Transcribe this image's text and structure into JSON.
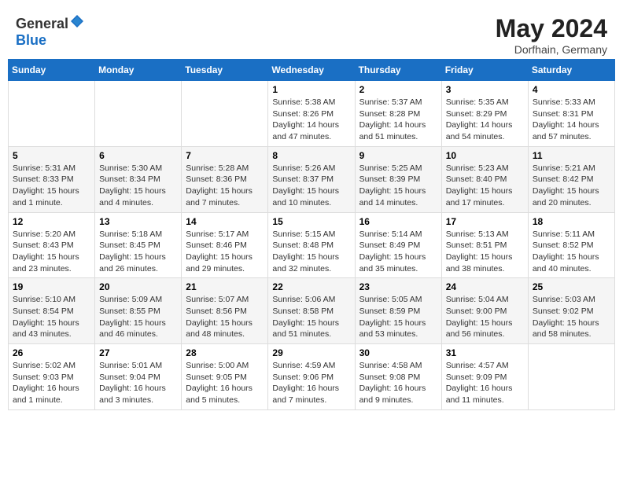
{
  "header": {
    "logo_general": "General",
    "logo_blue": "Blue",
    "month": "May 2024",
    "location": "Dorfhain, Germany"
  },
  "weekdays": [
    "Sunday",
    "Monday",
    "Tuesday",
    "Wednesday",
    "Thursday",
    "Friday",
    "Saturday"
  ],
  "weeks": [
    [
      null,
      null,
      null,
      {
        "day": "1",
        "sunrise": "Sunrise: 5:38 AM",
        "sunset": "Sunset: 8:26 PM",
        "daylight": "Daylight: 14 hours and 47 minutes."
      },
      {
        "day": "2",
        "sunrise": "Sunrise: 5:37 AM",
        "sunset": "Sunset: 8:28 PM",
        "daylight": "Daylight: 14 hours and 51 minutes."
      },
      {
        "day": "3",
        "sunrise": "Sunrise: 5:35 AM",
        "sunset": "Sunset: 8:29 PM",
        "daylight": "Daylight: 14 hours and 54 minutes."
      },
      {
        "day": "4",
        "sunrise": "Sunrise: 5:33 AM",
        "sunset": "Sunset: 8:31 PM",
        "daylight": "Daylight: 14 hours and 57 minutes."
      }
    ],
    [
      {
        "day": "5",
        "sunrise": "Sunrise: 5:31 AM",
        "sunset": "Sunset: 8:33 PM",
        "daylight": "Daylight: 15 hours and 1 minute."
      },
      {
        "day": "6",
        "sunrise": "Sunrise: 5:30 AM",
        "sunset": "Sunset: 8:34 PM",
        "daylight": "Daylight: 15 hours and 4 minutes."
      },
      {
        "day": "7",
        "sunrise": "Sunrise: 5:28 AM",
        "sunset": "Sunset: 8:36 PM",
        "daylight": "Daylight: 15 hours and 7 minutes."
      },
      {
        "day": "8",
        "sunrise": "Sunrise: 5:26 AM",
        "sunset": "Sunset: 8:37 PM",
        "daylight": "Daylight: 15 hours and 10 minutes."
      },
      {
        "day": "9",
        "sunrise": "Sunrise: 5:25 AM",
        "sunset": "Sunset: 8:39 PM",
        "daylight": "Daylight: 15 hours and 14 minutes."
      },
      {
        "day": "10",
        "sunrise": "Sunrise: 5:23 AM",
        "sunset": "Sunset: 8:40 PM",
        "daylight": "Daylight: 15 hours and 17 minutes."
      },
      {
        "day": "11",
        "sunrise": "Sunrise: 5:21 AM",
        "sunset": "Sunset: 8:42 PM",
        "daylight": "Daylight: 15 hours and 20 minutes."
      }
    ],
    [
      {
        "day": "12",
        "sunrise": "Sunrise: 5:20 AM",
        "sunset": "Sunset: 8:43 PM",
        "daylight": "Daylight: 15 hours and 23 minutes."
      },
      {
        "day": "13",
        "sunrise": "Sunrise: 5:18 AM",
        "sunset": "Sunset: 8:45 PM",
        "daylight": "Daylight: 15 hours and 26 minutes."
      },
      {
        "day": "14",
        "sunrise": "Sunrise: 5:17 AM",
        "sunset": "Sunset: 8:46 PM",
        "daylight": "Daylight: 15 hours and 29 minutes."
      },
      {
        "day": "15",
        "sunrise": "Sunrise: 5:15 AM",
        "sunset": "Sunset: 8:48 PM",
        "daylight": "Daylight: 15 hours and 32 minutes."
      },
      {
        "day": "16",
        "sunrise": "Sunrise: 5:14 AM",
        "sunset": "Sunset: 8:49 PM",
        "daylight": "Daylight: 15 hours and 35 minutes."
      },
      {
        "day": "17",
        "sunrise": "Sunrise: 5:13 AM",
        "sunset": "Sunset: 8:51 PM",
        "daylight": "Daylight: 15 hours and 38 minutes."
      },
      {
        "day": "18",
        "sunrise": "Sunrise: 5:11 AM",
        "sunset": "Sunset: 8:52 PM",
        "daylight": "Daylight: 15 hours and 40 minutes."
      }
    ],
    [
      {
        "day": "19",
        "sunrise": "Sunrise: 5:10 AM",
        "sunset": "Sunset: 8:54 PM",
        "daylight": "Daylight: 15 hours and 43 minutes."
      },
      {
        "day": "20",
        "sunrise": "Sunrise: 5:09 AM",
        "sunset": "Sunset: 8:55 PM",
        "daylight": "Daylight: 15 hours and 46 minutes."
      },
      {
        "day": "21",
        "sunrise": "Sunrise: 5:07 AM",
        "sunset": "Sunset: 8:56 PM",
        "daylight": "Daylight: 15 hours and 48 minutes."
      },
      {
        "day": "22",
        "sunrise": "Sunrise: 5:06 AM",
        "sunset": "Sunset: 8:58 PM",
        "daylight": "Daylight: 15 hours and 51 minutes."
      },
      {
        "day": "23",
        "sunrise": "Sunrise: 5:05 AM",
        "sunset": "Sunset: 8:59 PM",
        "daylight": "Daylight: 15 hours and 53 minutes."
      },
      {
        "day": "24",
        "sunrise": "Sunrise: 5:04 AM",
        "sunset": "Sunset: 9:00 PM",
        "daylight": "Daylight: 15 hours and 56 minutes."
      },
      {
        "day": "25",
        "sunrise": "Sunrise: 5:03 AM",
        "sunset": "Sunset: 9:02 PM",
        "daylight": "Daylight: 15 hours and 58 minutes."
      }
    ],
    [
      {
        "day": "26",
        "sunrise": "Sunrise: 5:02 AM",
        "sunset": "Sunset: 9:03 PM",
        "daylight": "Daylight: 16 hours and 1 minute."
      },
      {
        "day": "27",
        "sunrise": "Sunrise: 5:01 AM",
        "sunset": "Sunset: 9:04 PM",
        "daylight": "Daylight: 16 hours and 3 minutes."
      },
      {
        "day": "28",
        "sunrise": "Sunrise: 5:00 AM",
        "sunset": "Sunset: 9:05 PM",
        "daylight": "Daylight: 16 hours and 5 minutes."
      },
      {
        "day": "29",
        "sunrise": "Sunrise: 4:59 AM",
        "sunset": "Sunset: 9:06 PM",
        "daylight": "Daylight: 16 hours and 7 minutes."
      },
      {
        "day": "30",
        "sunrise": "Sunrise: 4:58 AM",
        "sunset": "Sunset: 9:08 PM",
        "daylight": "Daylight: 16 hours and 9 minutes."
      },
      {
        "day": "31",
        "sunrise": "Sunrise: 4:57 AM",
        "sunset": "Sunset: 9:09 PM",
        "daylight": "Daylight: 16 hours and 11 minutes."
      },
      null
    ]
  ]
}
